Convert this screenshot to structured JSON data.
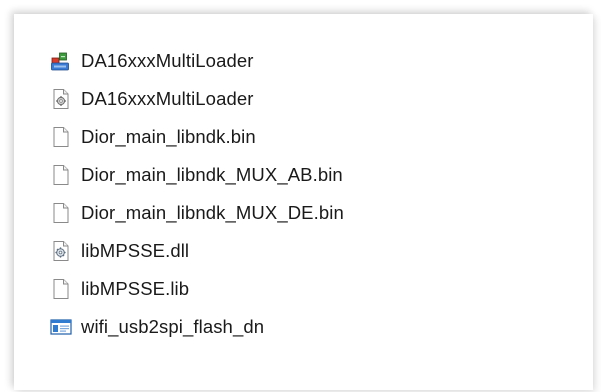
{
  "files": [
    {
      "name": "DA16xxxMultiLoader",
      "icon": "installer-app-icon"
    },
    {
      "name": "DA16xxxMultiLoader",
      "icon": "config-settings-file-icon"
    },
    {
      "name": "Dior_main_libndk.bin",
      "icon": "generic-file-icon"
    },
    {
      "name": "Dior_main_libndk_MUX_AB.bin",
      "icon": "generic-file-icon"
    },
    {
      "name": "Dior_main_libndk_MUX_DE.bin",
      "icon": "generic-file-icon"
    },
    {
      "name": "libMPSSE.dll",
      "icon": "dll-gear-file-icon"
    },
    {
      "name": "libMPSSE.lib",
      "icon": "generic-file-icon"
    },
    {
      "name": "wifi_usb2spi_flash_dn",
      "icon": "console-window-icon"
    }
  ]
}
